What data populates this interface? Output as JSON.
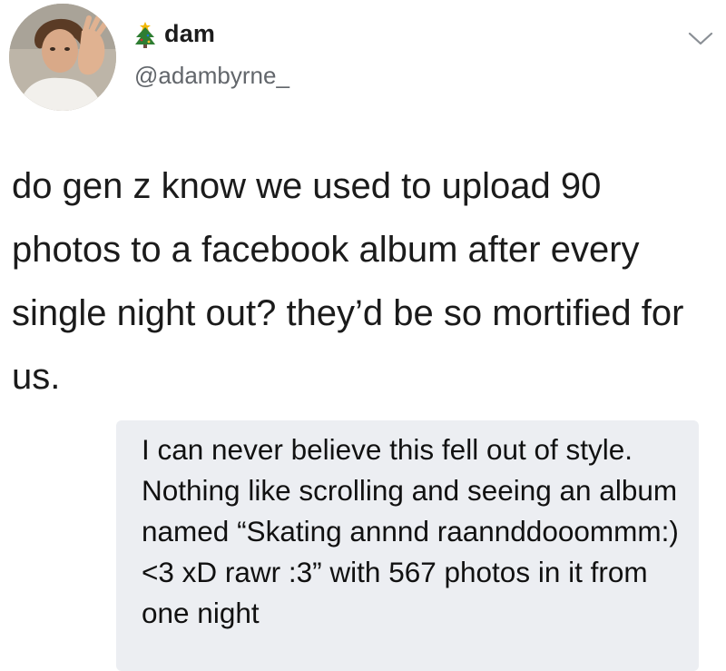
{
  "tweet": {
    "user": {
      "emoji_icon": "christmas-tree-icon",
      "display_name": "dam",
      "handle": "@adambyrne_"
    },
    "menu_icon": "chevron-down-icon",
    "text": "do gen z know we used to upload 90 photos to a facebook album after every single night out? they’d be so mortified for us."
  },
  "reply": {
    "text": "I can never believe this fell out of style. Nothing like scrolling and seeing an album named “Skating annnd raannddooommm:)<3 xD rawr :3” with 567 photos in it from one night"
  },
  "colors": {
    "reply_background": "#eceef2",
    "handle_gray": "#62666b",
    "chevron_gray": "#8a8f95",
    "tree_green": "#2e7d32"
  }
}
